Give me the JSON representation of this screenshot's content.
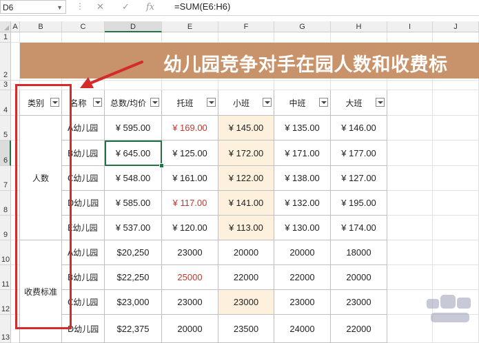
{
  "formula_bar": {
    "name_box": "D6",
    "cancel_icon": "✕",
    "enter_icon": "✓",
    "function_icon": "fx",
    "formula": "=SUM(E6:H6)"
  },
  "column_headers": [
    "A",
    "B",
    "C",
    "D",
    "E",
    "F",
    "G",
    "H",
    "I",
    "J"
  ],
  "row_headers": [
    "1",
    "2",
    "3",
    "4",
    "5",
    "6",
    "7",
    "8",
    "9",
    "10",
    "11",
    "12",
    "13"
  ],
  "title": "幼儿园竞争对手在园人数和收费标",
  "table": {
    "headers": [
      "类别",
      "名称",
      "总数/均价",
      "托班",
      "小班",
      "中班",
      "大班"
    ],
    "groups": [
      {
        "label": "人数",
        "rows": [
          {
            "name": "A幼儿园",
            "total": "¥ 595.00",
            "tuo": "¥ 169.00",
            "xiao": "¥ 145.00",
            "zhong": "¥ 135.00",
            "da": "¥ 146.00"
          },
          {
            "name": "B幼儿园",
            "total": "¥ 645.00",
            "tuo": "¥ 125.00",
            "xiao": "¥ 172.00",
            "zhong": "¥ 171.00",
            "da": "¥ 177.00"
          },
          {
            "name": "C幼儿园",
            "total": "¥ 548.00",
            "tuo": "¥ 161.00",
            "xiao": "¥ 122.00",
            "zhong": "¥ 138.00",
            "da": "¥ 127.00"
          },
          {
            "name": "D幼儿园",
            "total": "¥ 585.00",
            "tuo": "¥ 117.00",
            "xiao": "¥ 141.00",
            "zhong": "¥ 132.00",
            "da": "¥ 195.00"
          },
          {
            "name": "E幼儿园",
            "total": "¥ 537.00",
            "tuo": "¥ 120.00",
            "xiao": "¥ 113.00",
            "zhong": "¥ 130.00",
            "da": "¥ 174.00"
          }
        ]
      },
      {
        "label": "收费标准",
        "rows": [
          {
            "name": "A幼儿园",
            "total": "$20,250",
            "tuo": "23000",
            "xiao": "20000",
            "zhong": "20000",
            "da": "18000"
          },
          {
            "name": "B幼儿园",
            "total": "$22,250",
            "tuo": "25000",
            "xiao": "22000",
            "zhong": "22000",
            "da": "20000"
          },
          {
            "name": "C幼儿园",
            "total": "$23,000",
            "tuo": "23000",
            "xiao": "23000",
            "zhong": "23000",
            "da": "23000"
          },
          {
            "name": "D幼儿园",
            "total": "$22,375",
            "tuo": "20000",
            "xiao": "23500",
            "zhong": "24000",
            "da": "22000"
          }
        ]
      }
    ]
  },
  "colors": {
    "banner": "#c8936a",
    "highlight": "#fdf0dc",
    "red_text": "#c0392b",
    "selection": "#217346",
    "annotation": "#d42a2a"
  }
}
